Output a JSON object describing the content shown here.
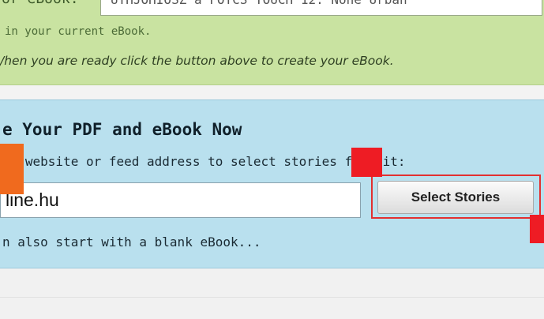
{
  "green_panel": {
    "partial_label": "or eBook:",
    "title_input_value": "UTHJOHIOSZ a FOTCS TOUCH 12: None Urban",
    "line1": "in your current eBook.",
    "line2": "/hen you are ready click the button above to create your eBook."
  },
  "create_panel": {
    "heading": "e Your PDF and eBook Now",
    "instruction": "g, website or feed address to select stories from it:",
    "url_value": "line.hu",
    "select_button_label": "Select Stories",
    "blank_text": "n also start with a blank eBook..."
  },
  "colors": {
    "green_panel": "#c9e3a1",
    "blue_panel": "#b9e0ee",
    "highlight_red": "#e23030",
    "marker_orange": "#f06a1e",
    "marker_red": "#ee1c24"
  }
}
